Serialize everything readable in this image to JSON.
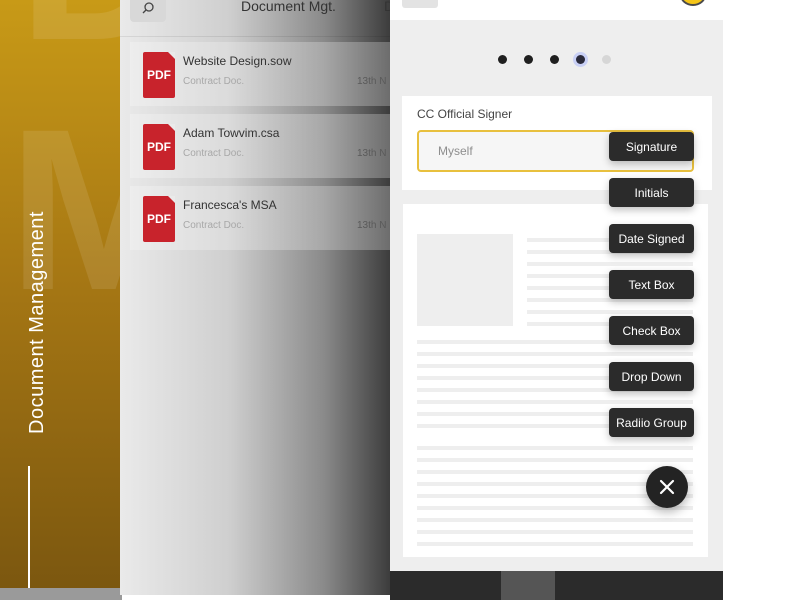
{
  "brand": {
    "vertical_title": "Document Management",
    "watermark_letter_top": "D",
    "watermark_letter": "M",
    "gold_color": "#b8860b"
  },
  "doc_list": {
    "title": "Document Mgt.",
    "title_extra": "D",
    "search_icon": "search-icon",
    "items": [
      {
        "name": "Website Design.sow",
        "type": "Contract Doc.",
        "date": "13th N",
        "icon_label": "PDF"
      },
      {
        "name": "Adam Towvim.csa",
        "type": "Contract Doc.",
        "date": "13th N",
        "icon_label": "PDF"
      },
      {
        "name": "Francesca's MSA",
        "type": "Contract Doc.",
        "date": "13th N",
        "icon_label": "PDF"
      }
    ],
    "pdf_color": "#c8232c"
  },
  "form": {
    "step_dots": 5,
    "active_step": 4,
    "signer": {
      "label": "CC Official Signer",
      "value": "Myself"
    },
    "field_buttons": [
      {
        "label": "Signature"
      },
      {
        "label": "Initials"
      },
      {
        "label": "Date Signed"
      },
      {
        "label": "Text Box"
      },
      {
        "label": "Check Box"
      },
      {
        "label": "Drop Down"
      },
      {
        "label": "Radiio Group"
      }
    ],
    "close_icon": "close-icon",
    "accent_color": "#e8c03e"
  }
}
